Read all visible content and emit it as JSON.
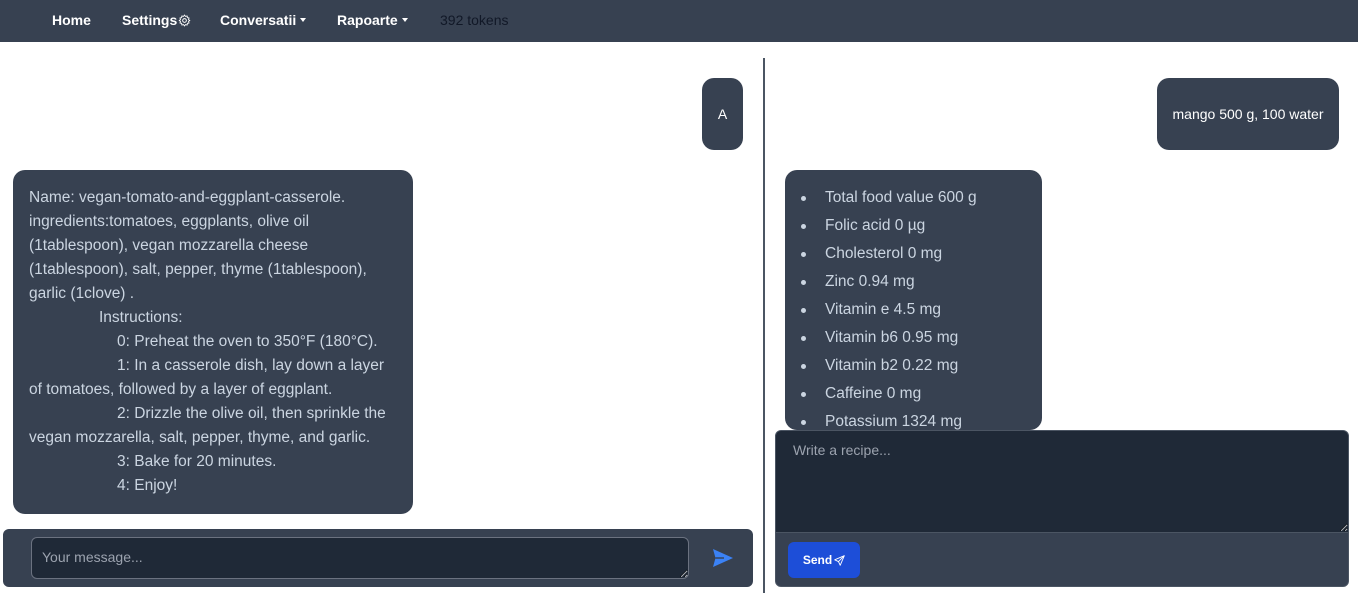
{
  "nav": {
    "home": "Home",
    "settings": "Settings",
    "conversations": "Conversatii",
    "reports": "Rapoarte",
    "tokens": "392 tokens"
  },
  "left_chat": {
    "user_message": "A",
    "recipe": {
      "name_line": "Name: vegan-tomato-and-eggplant-casserole.",
      "ingredients_line": "ingredients:tomatoes, eggplants, olive oil (1tablespoon), vegan mozzarella cheese (1tablespoon), salt, pepper, thyme (1tablespoon), garlic (1clove) .",
      "instructions_label": "Instructions:",
      "steps": [
        "0: Preheat the oven to 350°F (180°C).",
        "1: In a casserole dish, lay down a layer of tomatoes, followed by a layer of eggplant.",
        "2: Drizzle the olive oil, then sprinkle the vegan mozzarella, salt, pepper, thyme, and garlic.",
        "3: Bake for 20 minutes.",
        "4: Enjoy!"
      ]
    },
    "input_placeholder": "Your message..."
  },
  "right_chat": {
    "user_message": "mango 500 g, 100 water",
    "nutrients": [
      "Total food value 600 g",
      "Folic acid 0 µg",
      "Cholesterol 0 mg",
      "Zinc 0.94 mg",
      "Vitamin e 4.5 mg",
      "Vitamin b6 0.95 mg",
      "Vitamin b2 0.22 mg",
      "Caffeine 0 mg",
      "Potassium 1324 mg"
    ],
    "input_placeholder": "Write a recipe...",
    "send_label": "Send"
  },
  "colors": {
    "navbar": "#374151",
    "bubble": "#374151",
    "input_bg": "#1f2937",
    "send_button": "#1d4ed8",
    "send_arrow": "#3b82f6"
  },
  "icons": {
    "settings": "gear-icon",
    "dropdown": "caret-down-icon",
    "send": "paper-plane-icon"
  }
}
